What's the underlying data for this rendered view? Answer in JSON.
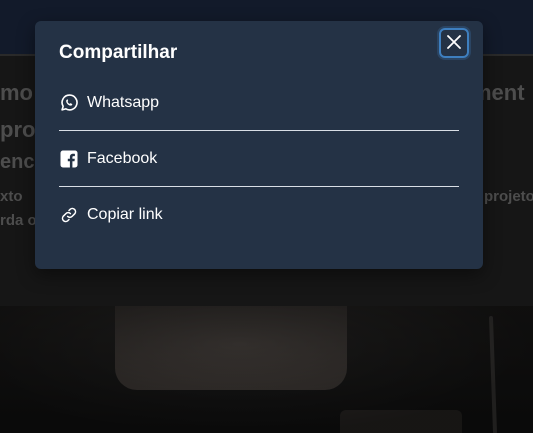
{
  "background": {
    "title_left": "mo",
    "title_right": "ment",
    "line2": "proj",
    "line3": "enci",
    "body1_left": "xto",
    "body1_right": "projeto",
    "body2_left": "rda o"
  },
  "modal": {
    "title": "Compartilhar",
    "close_icon": "close-icon",
    "items": [
      {
        "label": "Whatsapp",
        "icon": "whatsapp-icon"
      },
      {
        "label": "Facebook",
        "icon": "facebook-icon"
      },
      {
        "label": "Copiar link",
        "icon": "link-icon"
      }
    ]
  },
  "colors": {
    "modal_bg": "#243245",
    "focus_ring": "#3e7fbf",
    "divider": "#d9dee5",
    "text": "#ffffff"
  }
}
